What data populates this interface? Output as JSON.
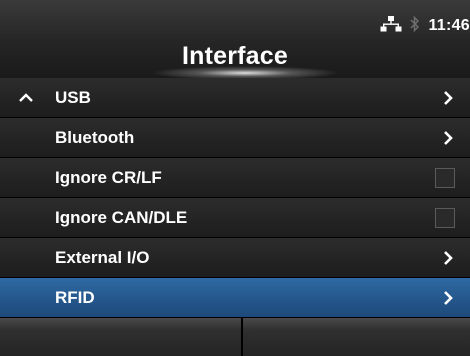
{
  "header": {
    "title": "Interface",
    "time": "11:46",
    "status_icons": [
      "network-icon",
      "bluetooth-icon"
    ]
  },
  "menu": {
    "items": [
      {
        "label": "USB",
        "control": "chevron",
        "expanded_marker": true
      },
      {
        "label": "Bluetooth",
        "control": "chevron"
      },
      {
        "label": "Ignore CR/LF",
        "control": "checkbox",
        "checked": false
      },
      {
        "label": "Ignore CAN/DLE",
        "control": "checkbox",
        "checked": false
      },
      {
        "label": "External I/O",
        "control": "chevron"
      },
      {
        "label": "RFID",
        "control": "chevron",
        "selected": true
      }
    ]
  },
  "colors": {
    "selected_row": "#2a63a0",
    "row_background": "#262626",
    "text": "#ffffff"
  },
  "softkeys": {
    "left": "",
    "right": ""
  }
}
